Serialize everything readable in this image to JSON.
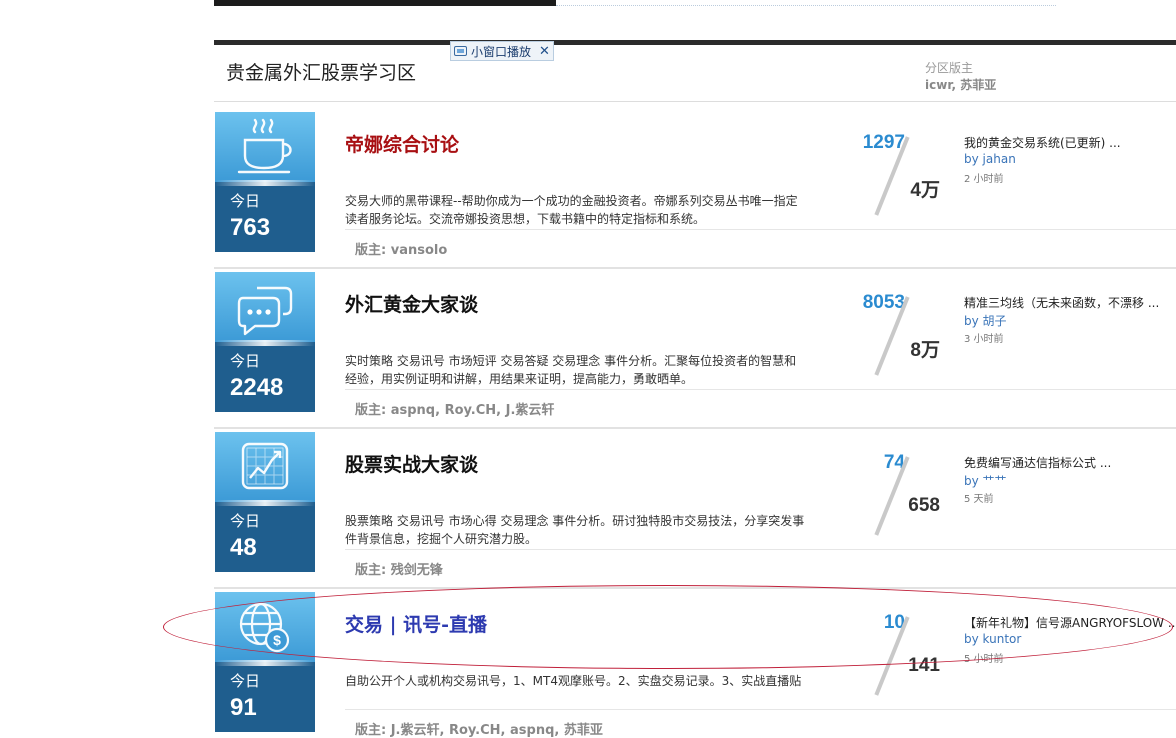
{
  "popup": {
    "label": "小窗口播放",
    "close": "✕"
  },
  "section": {
    "title": "贵金属外汇股票学习区",
    "mods_label": "分区版主",
    "mods": "icwr, 苏菲亚"
  },
  "forums": [
    {
      "icon": "coffee-cup-icon",
      "today_label": "今日",
      "today": "763",
      "name": "帝娜综合讨论",
      "name_color": "#a80f12",
      "desc": "交易大师的黑带课程--帮助你成为一个成功的金融投资者。帝娜系列交易丛书唯一指定读者服务论坛。交流帝娜投资思想，下载书籍中的特定指标和系统。",
      "mods": "版主: vansolo",
      "threads": "1297",
      "posts": "4万",
      "last_title": "我的黄金交易系统(已更新) ...",
      "last_by_label": "by",
      "last_by": "jahan",
      "last_time": "2 小时前"
    },
    {
      "icon": "chat-bubbles-icon",
      "today_label": "今日",
      "today": "2248",
      "name": "外汇黄金大家谈",
      "name_color": "#111111",
      "desc": "实时策略  交易讯号  市场短评  交易答疑  交易理念  事件分析。汇聚每位投资者的智慧和经验，用实例证明和讲解，用结果来证明，提高能力，勇敢晒单。",
      "mods": "版主: aspnq, Roy.CH, J.紫云轩",
      "threads": "8053",
      "posts": "8万",
      "last_title": "精准三均线（无未来函数，不漂移 ...",
      "last_by_label": "by",
      "last_by": "胡子",
      "last_time": "3 小时前"
    },
    {
      "icon": "stock-chart-icon",
      "today_label": "今日",
      "today": "48",
      "name": "股票实战大家谈",
      "name_color": "#111111",
      "desc": "股票策略  交易讯号  市场心得  交易理念  事件分析。研讨独特股市交易技法，分享突发事件背景信息，挖掘个人研究潜力股。",
      "mods": "版主: 残剑无锋",
      "threads": "74",
      "posts": "658",
      "last_title": "免费编写通达信指标公式  ...",
      "last_by_label": "by",
      "last_by": "艹艹",
      "last_time": "5 天前"
    },
    {
      "icon": "globe-dollar-icon",
      "today_label": "今日",
      "today": "91",
      "name": "交易 | 讯号-直播",
      "name_color": "#2d3ab0",
      "desc": "自助公开个人或机构交易讯号，1、MT4观摩账号。2、实盘交易记录。3、实战直播贴",
      "mods": "版主: J.紫云轩, Roy.CH, aspnq, 苏菲亚",
      "threads": "10",
      "posts": "141",
      "last_title": "【新年礼物】信号源ANGRYOFSLOW ...",
      "last_by_label": "by",
      "last_by": "kuntor",
      "last_time": "5 小时前"
    }
  ]
}
